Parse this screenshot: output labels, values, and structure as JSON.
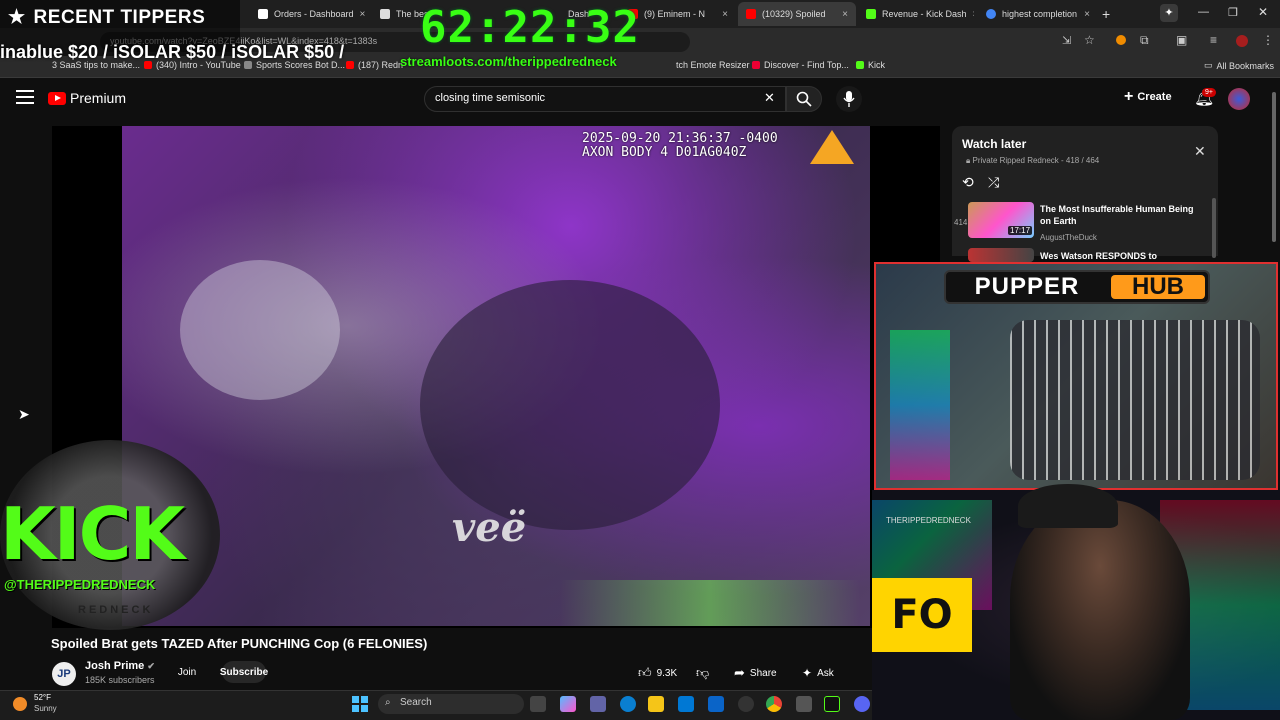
{
  "browser": {
    "tabs": [
      {
        "label": "Orders - Dashboard",
        "color": "#ffffff"
      },
      {
        "label": "The best",
        "color": "#dddddd"
      },
      {
        "label": "Dash",
        "color": "#53fc18"
      },
      {
        "label": "(9) Eminem - N",
        "color": "#ff0000"
      },
      {
        "label": "(10329) Spoiled",
        "color": "#ff0000"
      },
      {
        "label": "Revenue - Kick Dash",
        "color": "#53fc18"
      },
      {
        "label": "highest completion",
        "color": "#4285f4"
      }
    ],
    "url": "youtube.com/watch?v=ZeoBZE4iiKo&list=WL&index=418&t=1383s",
    "bookmarks": [
      {
        "label": "3 SaaS tips to make...",
        "color": "#aaaaaa"
      },
      {
        "label": "(340) Intro - YouTube",
        "color": "#ff0000"
      },
      {
        "label": "Sports Scores Bot D...",
        "color": "#888888"
      },
      {
        "label": "(187) Redn",
        "color": "#ff0000"
      },
      {
        "label": "tch Emote Resizer",
        "color": "#9146ff"
      },
      {
        "label": "Discover - Find Top...",
        "color": "#e03"
      },
      {
        "label": "Kick",
        "color": "#53fc18"
      },
      {
        "label": "All Bookmarks",
        "color": "#aaaaaa"
      }
    ]
  },
  "overlay": {
    "tippers_title": "RECENT TIPPERS",
    "tippers_list": "inablue $20 / iSOLAR $50 / iSOLAR $50 /",
    "timer": "62:22:32",
    "streamloots": "streamloots.com/therippedredneck",
    "kick_logo": "KICK",
    "kick_handle": "@THERIPPEDREDNECK",
    "kick_sub": "REDNECK"
  },
  "youtube": {
    "logo": "Premium",
    "search_value": "closing time semisonic",
    "create_label": "Create",
    "notif_count": "9+",
    "video": {
      "timestamp_line1": "2025-09-20 21:36:37 -0400",
      "timestamp_line2": "AXON BODY 4 D01AG040Z",
      "watermark": "veë",
      "title": "Spoiled Brat gets TAZED After PUNCHING Cop (6 FELONIES)",
      "channel": "Josh Prime",
      "channel_initials": "JP",
      "subs": "185K subscribers",
      "join": "Join",
      "subscribe": "Subscribe",
      "likes": "9.3K",
      "share": "Share",
      "ask": "Ask"
    },
    "watch_later": {
      "title": "Watch later",
      "subtitle": "Private Ripped Redneck - 418 / 464",
      "items": [
        {
          "index": "414",
          "title": "The Most Insufferable Human Being on Earth",
          "channel": "AugustTheDuck",
          "duration": "17:17"
        },
        {
          "index": "",
          "title": "Wes Watson RESPONDS to",
          "channel": "",
          "duration": ""
        }
      ]
    }
  },
  "cams": {
    "pupper_a": "PUPPER",
    "pupper_b": "HUB",
    "webcam_text": "THERIPPEDREDNECK",
    "gfo": "FO"
  },
  "taskbar": {
    "temp": "52°F",
    "weather": "Sunny",
    "search": "Search"
  }
}
